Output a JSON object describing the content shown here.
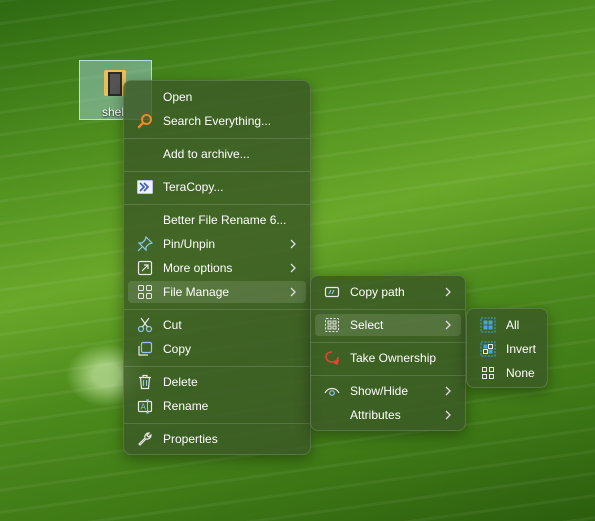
{
  "desktop": {
    "icon_label": "shel"
  },
  "main_menu": {
    "open": "Open",
    "search_everything": "Search Everything...",
    "add_to_archive": "Add to archive...",
    "teracopy": "TeraCopy...",
    "better_file_rename": "Better File Rename 6...",
    "pin_unpin": "Pin/Unpin",
    "more_options": "More options",
    "file_manage": "File Manage",
    "cut": "Cut",
    "copy": "Copy",
    "delete": "Delete",
    "rename": "Rename",
    "properties": "Properties"
  },
  "file_manage_menu": {
    "copy_path": "Copy path",
    "select": "Select",
    "take_ownership": "Take Ownership",
    "show_hide": "Show/Hide",
    "attributes": "Attributes"
  },
  "select_menu": {
    "all": "All",
    "invert": "Invert",
    "none": "None"
  },
  "icons": {
    "open": "none",
    "search_everything": "magnifier-icon",
    "teracopy": "teracopy-icon",
    "pin_unpin": "pin-icon",
    "more_options": "expand-icon",
    "file_manage": "grid-icon",
    "cut": "scissors-icon",
    "copy": "copy-icon",
    "delete": "trash-icon",
    "rename": "rename-icon",
    "properties": "wrench-icon"
  },
  "colors": {
    "menu_bg": "#3a5826",
    "highlight": "rgba(255,255,255,0.12)",
    "accent_search": "#f0862a",
    "accent_select": "#4aa3df",
    "accent_ownership": "#e0443c"
  }
}
